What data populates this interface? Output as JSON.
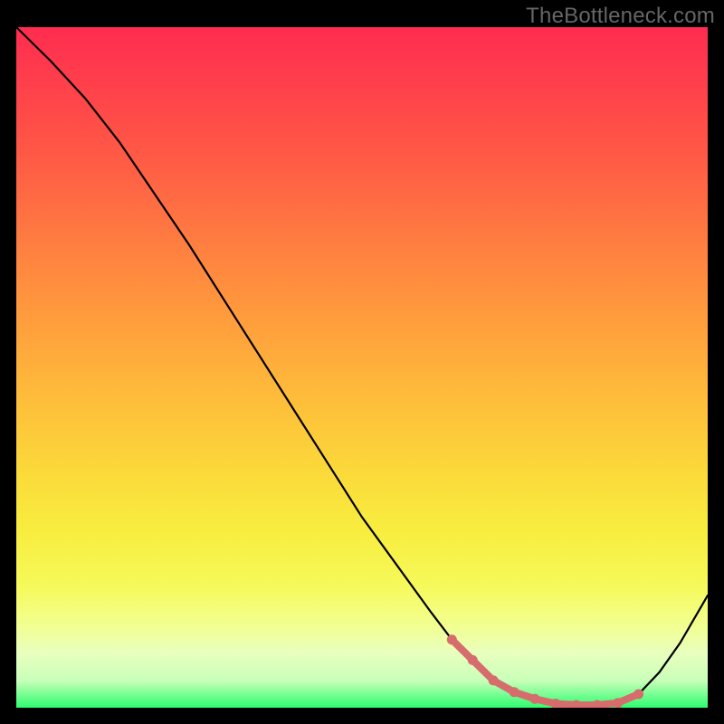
{
  "watermark": "TheBottleneck.com",
  "colors": {
    "curve_main": "#000000",
    "curve_highlight": "#d66d6c",
    "bg": "#000000"
  },
  "chart_data": {
    "type": "line",
    "title": "",
    "xlabel": "",
    "ylabel": "",
    "xlim": [
      0,
      100
    ],
    "ylim": [
      0,
      100
    ],
    "series": [
      {
        "name": "main-curve",
        "x": [
          0,
          5,
          10,
          15,
          20,
          25,
          30,
          35,
          40,
          45,
          50,
          55,
          60,
          63,
          66,
          69,
          72,
          75,
          78,
          81,
          84,
          87,
          90,
          93,
          96,
          100
        ],
        "y": [
          100,
          95,
          89.5,
          83,
          75.5,
          68,
          60,
          52,
          44,
          36,
          28,
          21,
          14,
          10,
          7,
          4,
          2.3,
          1.3,
          0.6,
          0.4,
          0.4,
          0.7,
          2,
          5.2,
          9.5,
          16.5
        ]
      },
      {
        "name": "highlight-segment",
        "x": [
          63,
          66,
          69,
          72,
          75,
          78,
          81,
          84,
          87,
          90
        ],
        "y": [
          10,
          7,
          4,
          2.3,
          1.3,
          0.6,
          0.4,
          0.4,
          0.7,
          2
        ]
      }
    ],
    "highlight_dots": {
      "x": [
        63,
        66,
        69,
        72,
        75,
        78,
        81,
        84,
        87,
        90
      ],
      "y": [
        10,
        7,
        4,
        2.3,
        1.3,
        0.6,
        0.4,
        0.4,
        0.7,
        2
      ]
    }
  }
}
